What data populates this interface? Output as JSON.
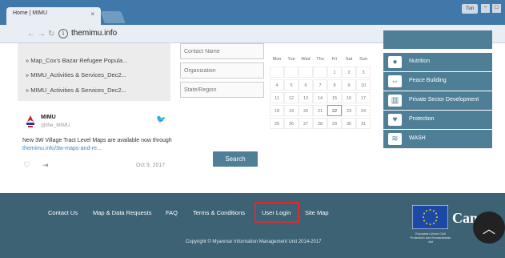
{
  "browser": {
    "tab_title": "Home | MIMU",
    "tab_close": "×",
    "user_button": "Tun",
    "minimize": "−",
    "maximize": "□",
    "back_glyph": "←",
    "forward_glyph": "→",
    "reload_glyph": "↻",
    "info_glyph": "i",
    "url": "themimu.info"
  },
  "left_links": [
    "» Map_Cox's Bazar Refugee Popula...",
    "» MIMU_Activities & Services_Dec2...",
    "» MIMU_Activities & Services_Dec2..."
  ],
  "tweet": {
    "name": "MIMU",
    "handle": "@the_MIMU",
    "text": "New 3W Village Tract Level Maps are available now through ",
    "link": "themimu.info/3w-maps-and-re...",
    "date": "Oct 9, 2017",
    "icons": [
      "twitter-icon",
      "heart-icon",
      "share-icon"
    ]
  },
  "search_form": {
    "contact_placeholder": "Contact Name",
    "organization_placeholder": "Organization",
    "region_placeholder": "State/Region",
    "search_label": "Search"
  },
  "calendar": {
    "headers": [
      "Mon",
      "Tue",
      "Wed",
      "Thu",
      "Fri",
      "Sat",
      "Sun"
    ],
    "weeks": [
      [
        "",
        "",
        "",
        "",
        "1",
        "2",
        "3"
      ],
      [
        "4",
        "5",
        "6",
        "7",
        "8",
        "9",
        "10"
      ],
      [
        "11",
        "12",
        "13",
        "14",
        "15",
        "16",
        "17"
      ],
      [
        "18",
        "19",
        "20",
        "21",
        "22",
        "23",
        "24"
      ],
      [
        "25",
        "26",
        "27",
        "28",
        "29",
        "30",
        "31"
      ]
    ],
    "today": "22"
  },
  "categories": [
    {
      "label": "",
      "icon": "blank-icon",
      "glyph": ""
    },
    {
      "label": "Nutrition",
      "icon": "nutrition-icon",
      "glyph": "●"
    },
    {
      "label": "Peace Building",
      "icon": "peace-building-icon",
      "glyph": "⇔"
    },
    {
      "label": "Private Sector Development",
      "icon": "private-sector-icon",
      "glyph": "▥"
    },
    {
      "label": "Protection",
      "icon": "protection-icon",
      "glyph": "♥"
    },
    {
      "label": "WASH",
      "icon": "wash-icon",
      "glyph": "≋"
    }
  ],
  "footer": {
    "links": [
      "Contact Us",
      "Map & Data Requests",
      "FAQ",
      "Terms & Conditions",
      "User Login",
      "Site Map"
    ],
    "copyright": "Copyright © Myanmar Information Management Unit 2014-2017",
    "eu_caption": "European Union Civil Protection and Humanitarian Aid",
    "canada_text": "Cana",
    "scroll_glyph": "︿"
  },
  "colors": {
    "chrome_blue": "#3f78a9",
    "accent_teal": "#4e7f97",
    "footer_bg": "#3c6274",
    "highlight_red": "#e12a2a"
  }
}
